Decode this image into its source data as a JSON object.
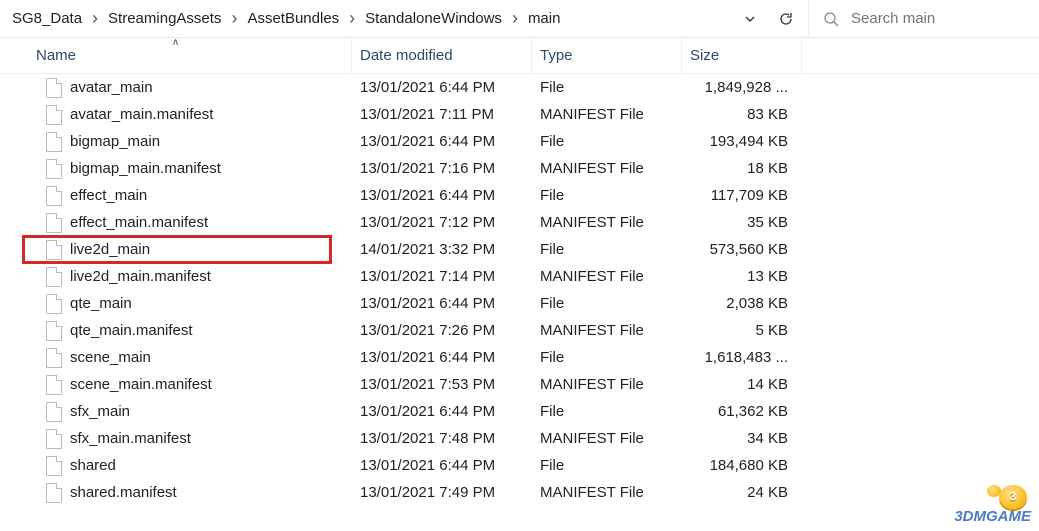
{
  "breadcrumb": [
    "SG8_Data",
    "StreamingAssets",
    "AssetBundles",
    "StandaloneWindows",
    "main"
  ],
  "nav": {
    "dropdown_icon": "chevron-down",
    "refresh_icon": "refresh"
  },
  "search": {
    "placeholder": "Search main",
    "icon": "search"
  },
  "columns": {
    "name": "Name",
    "date": "Date modified",
    "type": "Type",
    "size": "Size"
  },
  "sort": {
    "column": "name",
    "direction": "asc"
  },
  "files": [
    {
      "name": "avatar_main",
      "date": "13/01/2021 6:44 PM",
      "type": "File",
      "size": "1,849,928 ..."
    },
    {
      "name": "avatar_main.manifest",
      "date": "13/01/2021 7:11 PM",
      "type": "MANIFEST File",
      "size": "83 KB"
    },
    {
      "name": "bigmap_main",
      "date": "13/01/2021 6:44 PM",
      "type": "File",
      "size": "193,494 KB"
    },
    {
      "name": "bigmap_main.manifest",
      "date": "13/01/2021 7:16 PM",
      "type": "MANIFEST File",
      "size": "18 KB"
    },
    {
      "name": "effect_main",
      "date": "13/01/2021 6:44 PM",
      "type": "File",
      "size": "117,709 KB"
    },
    {
      "name": "effect_main.manifest",
      "date": "13/01/2021 7:12 PM",
      "type": "MANIFEST File",
      "size": "35 KB"
    },
    {
      "name": "live2d_main",
      "date": "14/01/2021 3:32 PM",
      "type": "File",
      "size": "573,560 KB"
    },
    {
      "name": "live2d_main.manifest",
      "date": "13/01/2021 7:14 PM",
      "type": "MANIFEST File",
      "size": "13 KB"
    },
    {
      "name": "qte_main",
      "date": "13/01/2021 6:44 PM",
      "type": "File",
      "size": "2,038 KB"
    },
    {
      "name": "qte_main.manifest",
      "date": "13/01/2021 7:26 PM",
      "type": "MANIFEST File",
      "size": "5 KB"
    },
    {
      "name": "scene_main",
      "date": "13/01/2021 6:44 PM",
      "type": "File",
      "size": "1,618,483 ..."
    },
    {
      "name": "scene_main.manifest",
      "date": "13/01/2021 7:53 PM",
      "type": "MANIFEST File",
      "size": "14 KB"
    },
    {
      "name": "sfx_main",
      "date": "13/01/2021 6:44 PM",
      "type": "File",
      "size": "61,362 KB"
    },
    {
      "name": "sfx_main.manifest",
      "date": "13/01/2021 7:48 PM",
      "type": "MANIFEST File",
      "size": "34 KB"
    },
    {
      "name": "shared",
      "date": "13/01/2021 6:44 PM",
      "type": "File",
      "size": "184,680 KB"
    },
    {
      "name": "shared.manifest",
      "date": "13/01/2021 7:49 PM",
      "type": "MANIFEST File",
      "size": "24 KB"
    }
  ],
  "highlight_index": 6,
  "watermark": "3DMGAME"
}
